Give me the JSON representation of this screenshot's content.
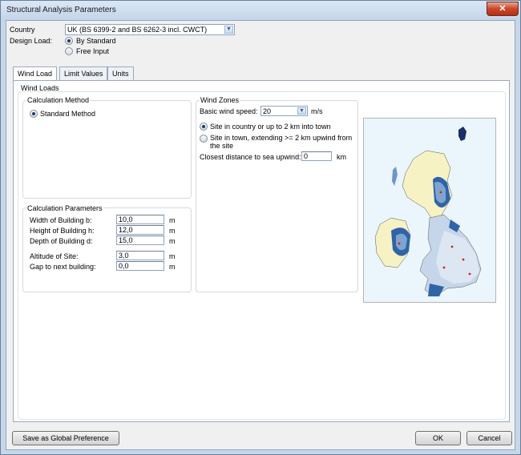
{
  "window": {
    "title": "Structural Analysis Parameters",
    "close_glyph": "✕"
  },
  "country": {
    "label": "Country",
    "selected": "UK (BS 6399-2 and BS 6262-3 incl. CWCT)"
  },
  "design_load": {
    "label": "Design Load:",
    "options": [
      {
        "label": "By Standard",
        "checked": true
      },
      {
        "label": "Free Input",
        "checked": false
      }
    ]
  },
  "tabs": [
    {
      "label": "Wind Load",
      "active": true
    },
    {
      "label": "Limit Values",
      "active": false
    },
    {
      "label": "Units",
      "active": false
    }
  ],
  "wind_loads": {
    "group_label": "Wind Loads",
    "calc_method": {
      "legend": "Calculation Method",
      "option": "Standard Method"
    },
    "calc_params": {
      "legend": "Calculation Parameters",
      "rows": [
        {
          "label": "Width of Building b:",
          "value": "10,0",
          "unit": "m"
        },
        {
          "label": "Height of Building h:",
          "value": "12,0",
          "unit": "m"
        },
        {
          "label": "Depth of Building d:",
          "value": "15,0",
          "unit": "m"
        },
        {
          "label": "Altitude of Site:",
          "value": "3,0",
          "unit": "m"
        },
        {
          "label": "Gap to next building:",
          "value": "0,0",
          "unit": "m"
        }
      ]
    },
    "wind_zones": {
      "legend": "Wind Zones",
      "basic_speed_label": "Basic wind speed:",
      "basic_speed_value": "20",
      "basic_speed_unit": "m/s",
      "site_options": [
        {
          "label": "Site in country or up to 2 km into town",
          "checked": true
        },
        {
          "label": "Site in town, extending >= 2 km upwind from the site",
          "checked": false
        }
      ],
      "sea_distance_label": "Closest distance to sea upwind:",
      "sea_distance_value": "0",
      "sea_distance_unit": "km"
    }
  },
  "footer": {
    "save_global": "Save as Global Preference",
    "ok": "OK",
    "cancel": "Cancel"
  },
  "colors": {
    "sea": "#eaf6fb",
    "land_light": "#f7f2c4",
    "zone_light": "#c5d6ea",
    "zone_mid": "#7fa4d0",
    "zone_dark": "#2f64a8"
  }
}
